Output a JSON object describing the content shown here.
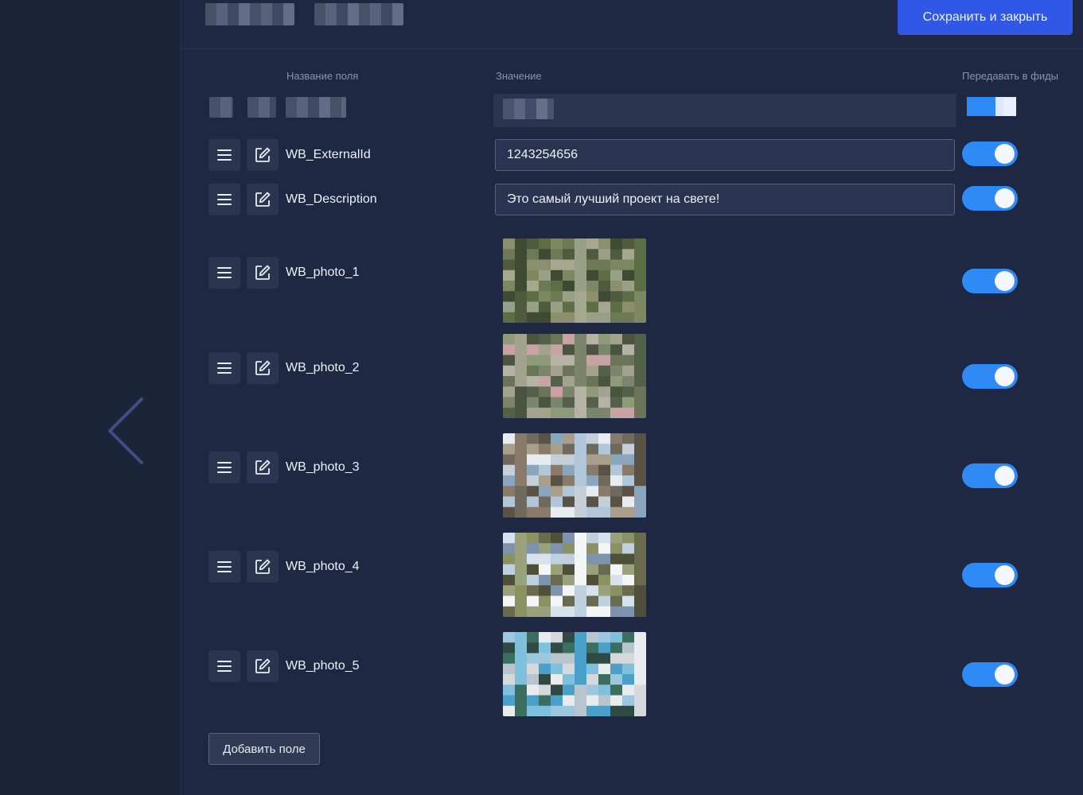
{
  "header": {
    "save_close_label": "Сохранить и закрыть"
  },
  "columns": {
    "field_name": "Название поля",
    "value": "Значение",
    "feeds": "Передавать в фиды"
  },
  "fields": [
    {
      "name": "WB_ExternalId",
      "type": "text",
      "value": "1243254656",
      "feed_enabled": true
    },
    {
      "name": "WB_Description",
      "type": "text",
      "value": "Это самый лучший проект на свете!",
      "feed_enabled": true
    },
    {
      "name": "WB_photo_1",
      "type": "image",
      "feed_enabled": true
    },
    {
      "name": "WB_photo_2",
      "type": "image",
      "feed_enabled": true
    },
    {
      "name": "WB_photo_3",
      "type": "image",
      "feed_enabled": true
    },
    {
      "name": "WB_photo_4",
      "type": "image",
      "feed_enabled": true
    },
    {
      "name": "WB_photo_5",
      "type": "image",
      "feed_enabled": true
    }
  ],
  "add_field_label": "Добавить поле",
  "colors": {
    "accent": "#3157e6",
    "toggle_on": "#2e8af6",
    "background": "#1f2842"
  },
  "icons": {
    "drag": "drag-handle-icon",
    "edit": "edit-icon",
    "back": "chevron-left-icon"
  }
}
